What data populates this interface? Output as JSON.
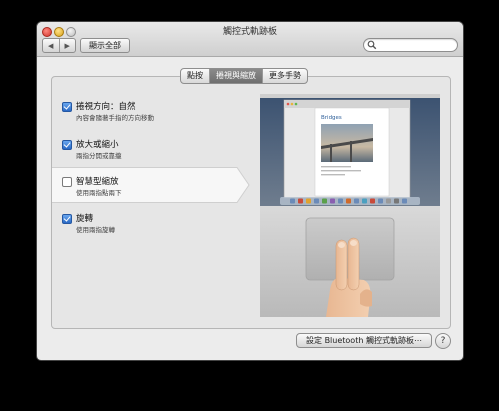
{
  "window": {
    "title": "觸控式軌跡板",
    "nav_back": "◀",
    "nav_forward": "▶",
    "show_all": "顯示全部",
    "search_placeholder": ""
  },
  "tabs": [
    {
      "label": "點按",
      "active": false
    },
    {
      "label": "捲視與縮放",
      "active": true
    },
    {
      "label": "更多手勢",
      "active": false
    }
  ],
  "options": [
    {
      "title": "捲視方向：自然",
      "subtitle": "內容會隨著手指的方向移動",
      "checked": true
    },
    {
      "title": "放大或縮小",
      "subtitle": "兩指分開或靠攏",
      "checked": true
    },
    {
      "title": "智慧型縮放",
      "subtitle": "使用兩指點兩下",
      "checked": false
    },
    {
      "title": "旋轉",
      "subtitle": "使用兩指旋轉",
      "checked": true
    }
  ],
  "preview": {
    "document_title": "Bridges"
  },
  "footer": {
    "bluetooth_button": "設定 Bluetooth 觸控式軌跡板⋯",
    "help": "?"
  },
  "colors": {
    "accent": "#2a69c5",
    "active_tab": "#7a7a7a"
  }
}
